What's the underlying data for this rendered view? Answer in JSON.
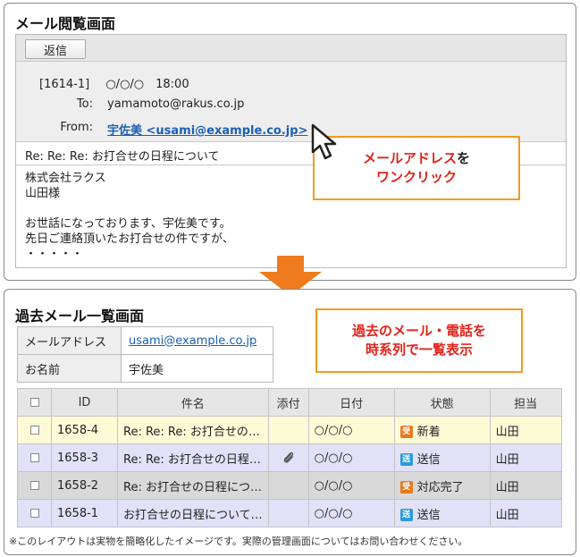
{
  "mail_view": {
    "title": "メール閲覧画面",
    "reply_label": "返信",
    "message_no": "[1614-1]",
    "datetime": "○/○/○　18:00",
    "to_label": "To:",
    "to_value": "yamamoto@rakus.co.jp",
    "from_label": "From:",
    "from_value": "宇佐美 <usami@example.co.jp>",
    "subject": "Re: Re: Re: お打合せの日程について",
    "body_lines": [
      "株式会社ラクス",
      "山田様",
      "",
      "お世話になっております、宇佐美です。",
      "先日ご連絡頂いたお打合せの件ですが、",
      "・・・・・"
    ]
  },
  "callout_top": {
    "red": "メールアドレス",
    "suffix": "を",
    "line2": "ワンクリック"
  },
  "history_view": {
    "title": "過去メール一覧画面",
    "info": {
      "email_label": "メールアドレス",
      "email_value": "usami@example.co.jp",
      "name_label": "お名前",
      "name_value": "宇佐美"
    },
    "columns": {
      "id": "ID",
      "subject": "件名",
      "attach": "添付",
      "date": "日付",
      "status": "状態",
      "owner": "担当"
    },
    "rows": [
      {
        "id": "1658-4",
        "subject": "Re: Re: Re: お打合せの…",
        "attach": "",
        "date": "○/○/○",
        "badge": "受",
        "status": "新着",
        "owner": "山田"
      },
      {
        "id": "1658-3",
        "subject": "Re: Re: お打合せの日程…",
        "attach": "clip",
        "date": "○/○/○",
        "badge": "送",
        "status": "送信",
        "owner": "山田"
      },
      {
        "id": "1658-2",
        "subject": "Re: お打合せの日程につ…",
        "attach": "",
        "date": "○/○/○",
        "badge": "受",
        "status": "対応完了",
        "owner": "山田"
      },
      {
        "id": "1658-1",
        "subject": "お打合せの日程について…",
        "attach": "",
        "date": "○/○/○",
        "badge": "送",
        "status": "送信",
        "owner": "山田"
      }
    ]
  },
  "callout_bottom": {
    "line1": "過去のメール・電話を",
    "line2": "時系列で一覧表示"
  },
  "footnote": "※このレイアウトは実物を簡略化したイメージです。実際の管理画面についてはお問い合わせください。",
  "colors": {
    "accent_orange": "#f39a1e",
    "callout_red": "#e2231a",
    "link_blue": "#1a5fb4",
    "arrow_orange": "#ee7c1e"
  }
}
